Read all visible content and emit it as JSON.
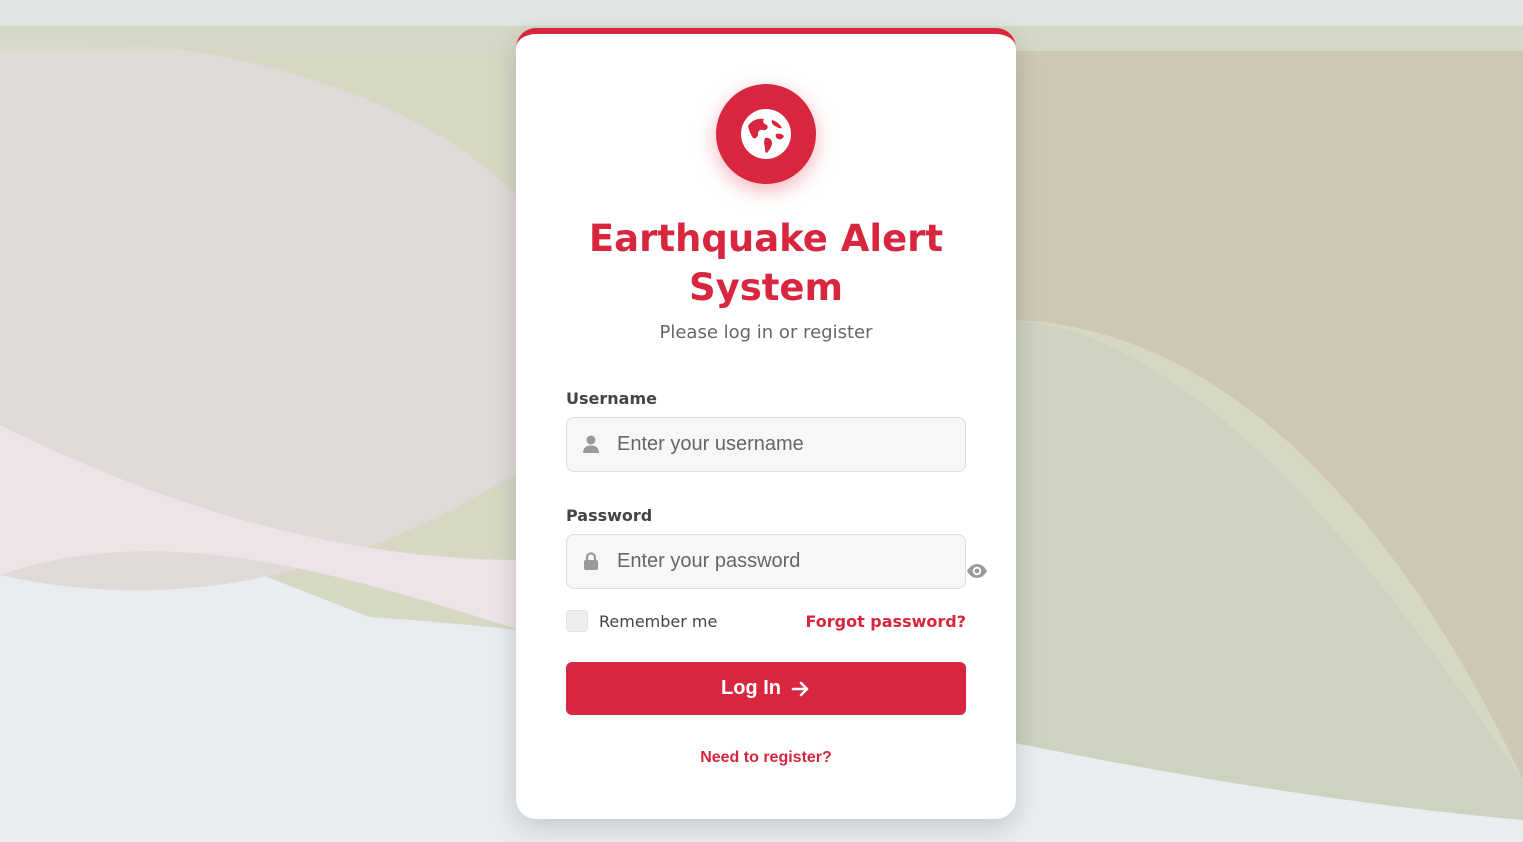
{
  "app": {
    "title": "Earthquake Alert System",
    "subtitle": "Please log in or register"
  },
  "form": {
    "username": {
      "label": "Username",
      "placeholder": "Enter your username",
      "value": "",
      "icon": "user-icon"
    },
    "password": {
      "label": "Password",
      "placeholder": "Enter your password",
      "value": "",
      "icon": "lock-icon",
      "toggle_icon": "eye-icon"
    },
    "remember_label": "Remember me",
    "remember_checked": false,
    "forgot_label": "Forgot password?",
    "login_label": "Log In",
    "register_label": "Need to register?"
  },
  "colors": {
    "accent": "#d7263d",
    "background": "#e9edf0",
    "input_background": "#f7f7f7"
  },
  "icons": {
    "logo": "globe-icon",
    "login_arrow": "arrow-right-icon"
  }
}
